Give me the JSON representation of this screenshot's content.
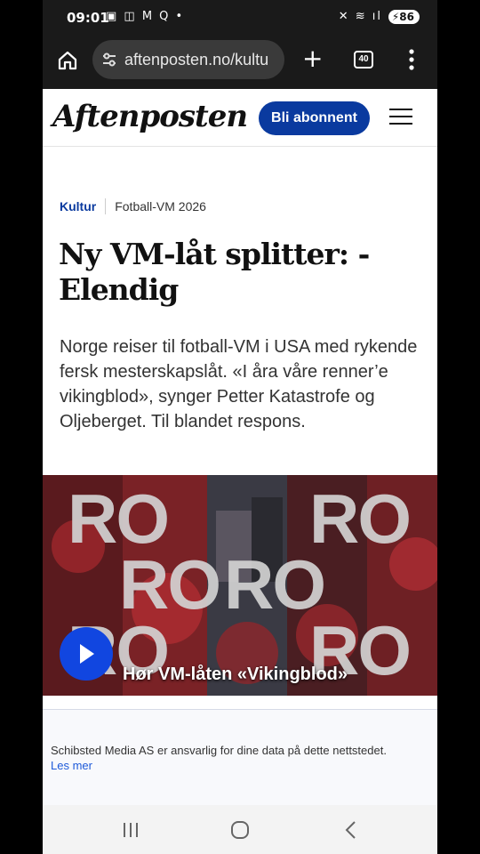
{
  "status_bar": {
    "time": "09:01",
    "left_icons": "▣ ◫ M Q •",
    "right_icons": "✕ ≋ ıl",
    "battery": "86"
  },
  "browser": {
    "url": "aftenposten.no/kultu",
    "tab_count": "40"
  },
  "site": {
    "logo": "Aftenposten",
    "subscribe_label": "Bli abonnent",
    "brand_color": "#0a3a9f"
  },
  "article": {
    "category": "Kultur",
    "topic": "Fotball-VM 2026",
    "headline": "Ny VM-låt splitter: - Elendig",
    "lead": "Norge reiser til fotball-VM i USA med rykende fersk mesterskapslåt. «I åra våre renner’e vikingblod», synger Petter Katastrofe og Oljeberget. Til blandet respons."
  },
  "video": {
    "overlay_word": "RO",
    "title": "Hør VM-låten «Vikingblod»"
  },
  "consent": {
    "text": "Schibsted Media AS er ansvarlig for dine data på dette nettstedet.",
    "link": "Les mer"
  },
  "icons": {
    "home": "home-icon",
    "tune": "tune-icon",
    "add": "plus-icon",
    "tabs": "tab-switcher-icon",
    "menu": "more-vert-icon",
    "hamburger": "hamburger-menu-icon",
    "play": "play-icon",
    "recents": "recents-icon",
    "home_nav": "home-circle-icon",
    "back": "back-chevron-icon"
  }
}
